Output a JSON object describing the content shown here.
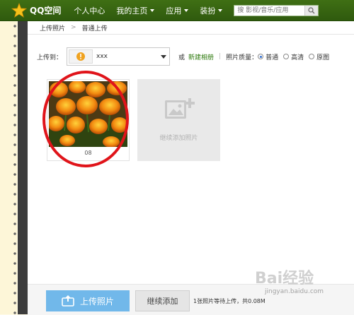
{
  "topbar": {
    "logo_text": "QQ空间",
    "nav": [
      {
        "label": "个人中心",
        "has_caret": false
      },
      {
        "label": "我的主页",
        "has_caret": true
      },
      {
        "label": "应用",
        "has_caret": true
      },
      {
        "label": "装扮",
        "has_caret": true
      }
    ],
    "search_placeholder": "搜 影视/音乐/应用",
    "search_icon": "search-icon"
  },
  "breadcrumb": {
    "items": [
      "上传照片",
      "普通上传"
    ],
    "separator": ">"
  },
  "upload_to": {
    "label": "上传到：",
    "album_name": "xxx",
    "or_text": "或",
    "new_album": "新建相册",
    "separator": "|",
    "quality_label": "照片质量：",
    "quality_options": [
      {
        "label": "普通",
        "selected": true
      },
      {
        "label": "高清",
        "selected": false
      },
      {
        "label": "原图",
        "selected": false
      }
    ]
  },
  "photos": [
    {
      "name": "08",
      "subject": "orange tulips"
    }
  ],
  "add_card": {
    "label": "继续添加照片",
    "icon": "add-photo-icon"
  },
  "bottom": {
    "upload_button": "上传照片",
    "continue_button": "继续添加",
    "status": "1张照片等待上传，共0.08M"
  },
  "watermark": {
    "main": "Bai经验",
    "sub": "jingyan.baidu.com"
  },
  "colors": {
    "topbar": "#35620f",
    "upload_button": "#71b8ea",
    "link_green": "#2e7a0e",
    "highlight": "#e0141a"
  }
}
